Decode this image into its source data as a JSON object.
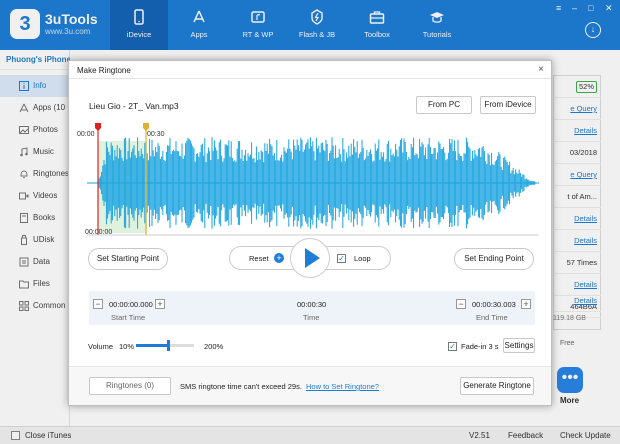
{
  "app": {
    "brand": "3uTools",
    "site": "www.3u.com",
    "logo_digit": "3"
  },
  "nav": [
    {
      "label": "iDevice",
      "icon": "phone-icon",
      "active": true
    },
    {
      "label": "Apps",
      "icon": "app-store-icon"
    },
    {
      "label": "RT & WP",
      "icon": "ringtone-wallpaper-icon"
    },
    {
      "label": "Flash & JB",
      "icon": "flash-icon"
    },
    {
      "label": "Toolbox",
      "icon": "toolbox-icon"
    },
    {
      "label": "Tutorials",
      "icon": "graduation-cap-icon"
    }
  ],
  "window_controls": [
    "≡",
    "–",
    "□",
    "✕"
  ],
  "sidebar": {
    "device": "Phuong's iPhone",
    "items": [
      {
        "label": "Info",
        "icon": "info-icon",
        "active": true
      },
      {
        "label": "Apps (10",
        "icon": "apps-icon"
      },
      {
        "label": "Photos",
        "icon": "photos-icon"
      },
      {
        "label": "Music",
        "icon": "music-icon"
      },
      {
        "label": "Ringtones",
        "icon": "bell-icon"
      },
      {
        "label": "Videos",
        "icon": "video-icon"
      },
      {
        "label": "Books",
        "icon": "book-icon"
      },
      {
        "label": "UDisk",
        "icon": "udisk-icon"
      },
      {
        "label": "Data",
        "icon": "data-icon"
      },
      {
        "label": "Files",
        "icon": "folder-icon"
      },
      {
        "label": "Common",
        "icon": "grid-icon"
      }
    ]
  },
  "right_panel": {
    "battery": "52%",
    "cells": [
      "e Query",
      "Details",
      "03/2018",
      "e Query",
      "t of Am...",
      "Details",
      "Details",
      "57 Times",
      "Details",
      "464B6A",
      "Details"
    ],
    "storage": "119.18 GB",
    "free": "Free",
    "more_label": "More",
    "more_icon": "•••"
  },
  "footer": {
    "close_itunes": "Close iTunes",
    "version": "V2.51",
    "feedback": "Feedback",
    "check_update": "Check Update"
  },
  "modal": {
    "title": "Make Ringtone",
    "close": "×",
    "file_name": "Lieu Gio - 2T_ Van.mp3",
    "from_pc": "From PC",
    "from_idevice": "From iDevice",
    "marker_start": "00:00",
    "marker_end": "00:30",
    "axis_start": "00:00:00",
    "set_start": "Set Starting Point",
    "reset": "Reset",
    "loop": "Loop",
    "loop_checked": true,
    "set_end": "Set Ending Point",
    "start_time_value": "00:00:00.000",
    "start_time_label": "Start Time",
    "time_value": "00:00:30",
    "time_label": "Time",
    "end_time_value": "00:00:30.003",
    "end_time_label": "End Time",
    "volume_label": "Volume",
    "volume_min": "10%",
    "volume_max": "200%",
    "volume_level": 0.55,
    "fade_in": "Fade-in 3 s",
    "fade_checked": true,
    "settings": "Settings",
    "ringtones_btn": "Ringtones (0)",
    "sms_note": "SMS ringtone time can't exceed 29s.",
    "howto_link": "How to Set Ringtone?",
    "generate": "Generate Ringtone",
    "colors": {
      "wave": "#1aa3e0",
      "selection": "#dff2de",
      "start_marker": "#e02020",
      "end_marker": "#e0b030"
    }
  }
}
